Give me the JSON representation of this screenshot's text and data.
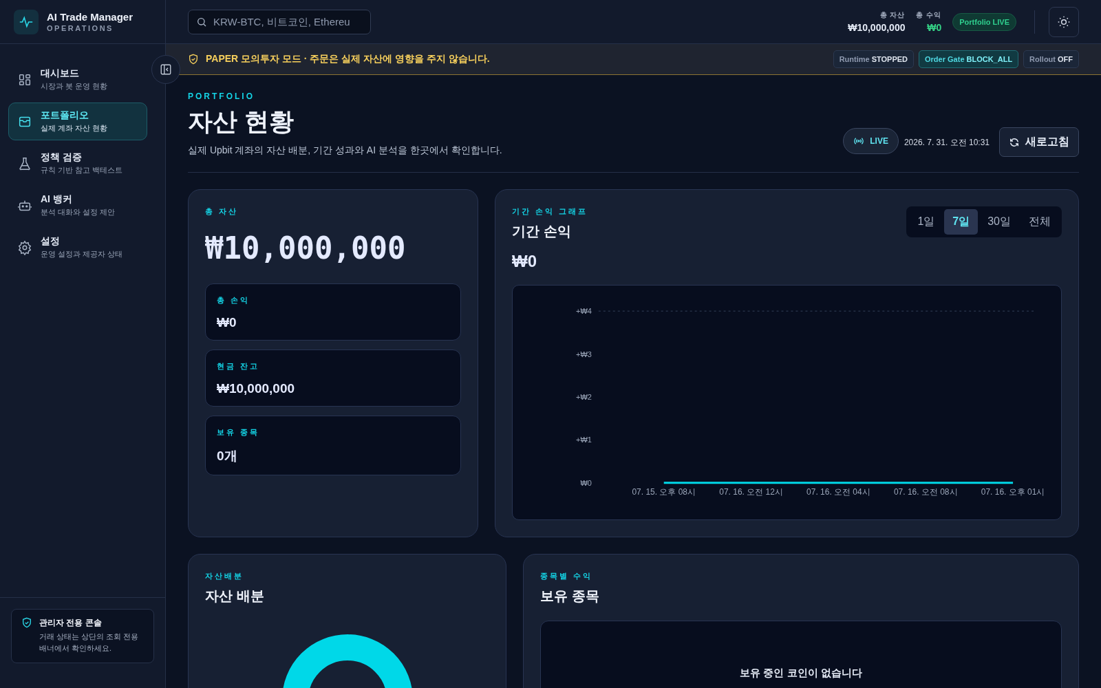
{
  "brand": {
    "title": "AI Trade Manager",
    "subtitle": "OPERATIONS"
  },
  "sidebar": {
    "items": [
      {
        "label": "대시보드",
        "description": "시장과 봇 운영 현황",
        "selected": false
      },
      {
        "label": "포트폴리오",
        "description": "실제 계좌 자산 현황",
        "selected": true
      },
      {
        "label": "정책 검증",
        "description": "규칙 기반 참고 백테스트",
        "selected": false
      },
      {
        "label": "AI 뱅커",
        "description": "분석 대화와 설정 제안",
        "selected": false
      },
      {
        "label": "설정",
        "description": "운영 설정과 제공자 상태",
        "selected": false
      }
    ],
    "notice": {
      "title": "관리자 전용 콘솔",
      "text": "거래 상태는 상단의 조회 전용 배너에서 확인하세요."
    }
  },
  "search": {
    "placeholder": "KRW-BTC, 비트코인, Ethereu"
  },
  "header_stats": [
    {
      "label": "총 자산",
      "value": "₩10,000,000",
      "kind": "total"
    },
    {
      "label": "총 수익",
      "value": "₩0",
      "kind": "profit"
    }
  ],
  "status_pill": "Portfolio LIVE",
  "banner": {
    "text": "PAPER 모의투자 모드 · 주문은 실제 자산에 영향을 주지 않습니다.",
    "chips": [
      {
        "label": "Runtime",
        "value": "STOPPED",
        "active": false
      },
      {
        "label": "Order Gate",
        "value": "BLOCK_ALL",
        "active": true
      },
      {
        "label": "Rollout",
        "value": "OFF",
        "active": false
      }
    ]
  },
  "page": {
    "eyebrow": "PORTFOLIO",
    "title": "자산 현황",
    "subtitle": "실제 Upbit 계좌의 자산 배분, 기간 성과와 AI 분석을 한곳에서 확인합니다.",
    "live_badge": "LIVE",
    "timestamp": "2026. 7. 31. 오전 10:31",
    "refresh_button": "새로고침"
  },
  "summary_card": {
    "eyebrow": "총 자산",
    "value": "₩10,000,000",
    "stats": [
      {
        "label": "총 손익",
        "value": "₩0"
      },
      {
        "label": "현금 잔고",
        "value": "₩10,000,000"
      },
      {
        "label": "보유 종목",
        "value": "0개"
      }
    ]
  },
  "pnl_card": {
    "eyebrow": "기간 손익 그래프",
    "title": "기간 손익",
    "value": "₩0",
    "ranges": [
      {
        "label": "1일",
        "selected": false
      },
      {
        "label": "7일",
        "selected": true
      },
      {
        "label": "30일",
        "selected": false
      },
      {
        "label": "전체",
        "selected": false
      }
    ],
    "chart_data": {
      "type": "line",
      "categories": [
        "07. 15. 오후 08시",
        "07. 16. 오전 12시",
        "07. 16. 오전 04시",
        "07. 16. 오전 08시",
        "07. 16. 오후 01시"
      ],
      "series": [
        {
          "color": "#00d8e8",
          "values": [
            0,
            0,
            0,
            0,
            0
          ]
        }
      ],
      "ylim": [
        0,
        4
      ],
      "yticks": [
        {
          "value": 0,
          "label": "₩0"
        },
        {
          "value": 1,
          "label": "+₩1"
        },
        {
          "value": 2,
          "label": "+₩2"
        },
        {
          "value": 3,
          "label": "+₩3"
        },
        {
          "value": 4,
          "label": "+₩4"
        }
      ]
    }
  },
  "allocation_card": {
    "eyebrow": "자산배분",
    "title": "자산 배분"
  },
  "holdings_card": {
    "eyebrow": "종목별 수익",
    "title": "보유 종목",
    "empty_text": "보유 중인 코인이 없습니다"
  }
}
